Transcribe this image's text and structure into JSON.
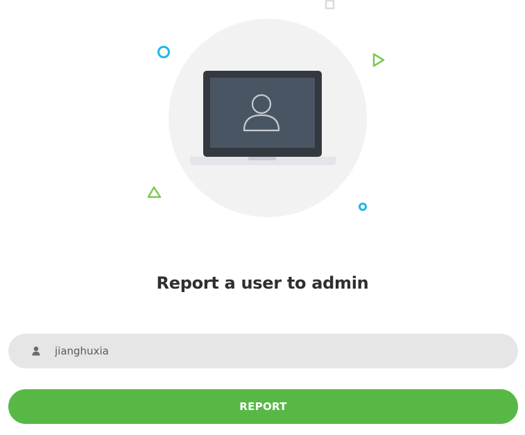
{
  "form": {
    "title": "Report a user to admin",
    "username_value": "jianghuxia",
    "username_icon": "user-icon",
    "submit_label": "REPORT"
  },
  "illustration": {
    "main_icon": "laptop-user-icon",
    "decorations": [
      "circle-outline-icon",
      "triangle-outline-icon",
      "square-outline-icon"
    ]
  },
  "colors": {
    "accent_green": "#57b846",
    "input_bg": "#e6e6e6",
    "decor_blue": "#1cb8e8",
    "decor_green": "#7cc84f",
    "circle_bg": "#f2f2f2",
    "laptop_screen": "#4a5563",
    "laptop_frame": "#33393f"
  }
}
